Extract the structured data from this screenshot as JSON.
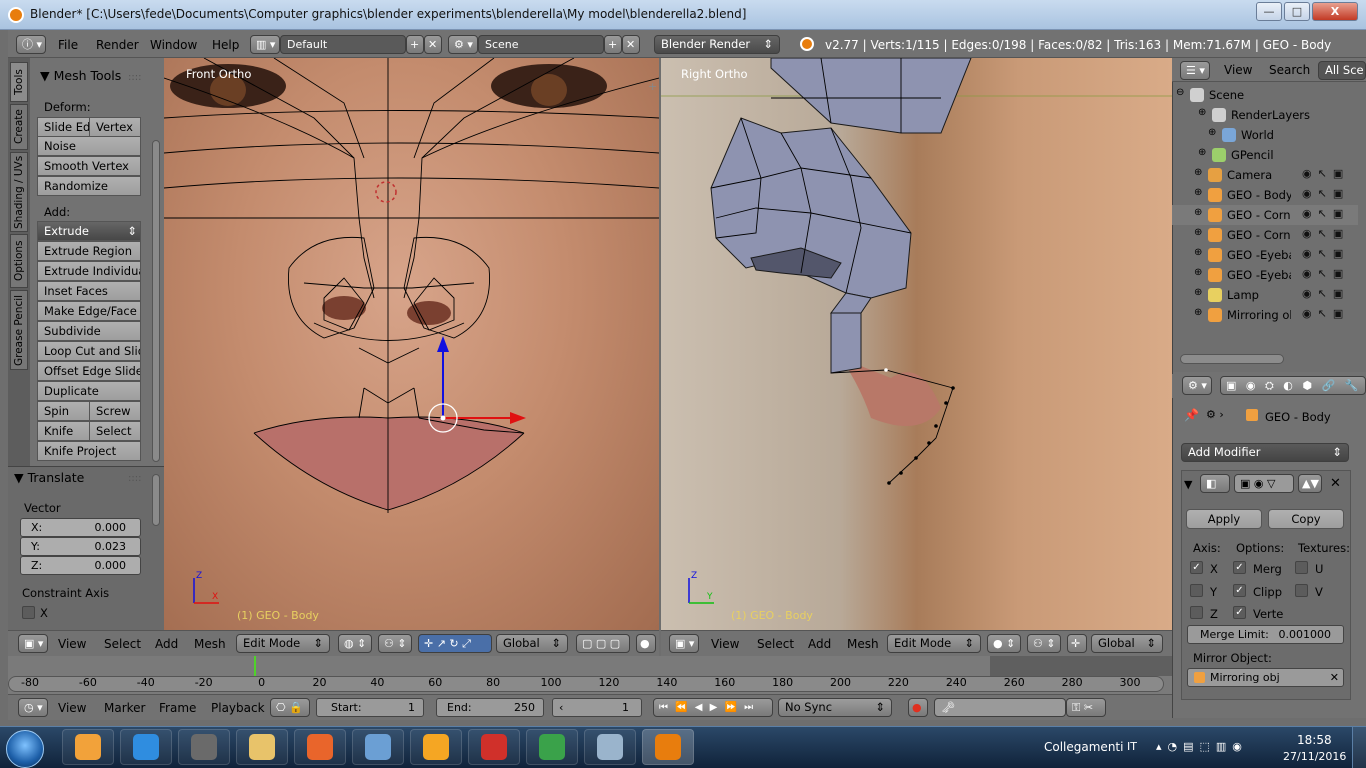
{
  "window": {
    "title": "Blender* [C:\\Users\\fede\\Documents\\Computer graphics\\blender experiments\\blenderella\\My model\\blenderella2.blend]",
    "minimize": "—",
    "maximize": "□",
    "close": "X"
  },
  "info_header": {
    "menus": [
      "File",
      "Render",
      "Window",
      "Help"
    ],
    "screen_layout": "Default",
    "scene": "Scene",
    "render_engine": "Blender Render",
    "stats": "v2.77 | Verts:1/115 | Edges:0/198 | Faces:0/82 | Tris:163 | Mem:71.67M | GEO - Body"
  },
  "left_tabs": [
    "Tools",
    "Create",
    "Shading / UVs",
    "Options",
    "Grease Pencil"
  ],
  "mesh_tools": {
    "title": "Mesh Tools",
    "deform_label": "Deform:",
    "slide_edge": "Slide Ed",
    "vertex": "Vertex",
    "noise": "Noise",
    "smooth_vertex": "Smooth Vertex",
    "randomize": "Randomize",
    "add_label": "Add:",
    "extrude": "Extrude",
    "add_items": [
      "Extrude Region",
      "Extrude Individual",
      "Inset Faces",
      "Make Edge/Face",
      "Subdivide",
      "Loop Cut and Slide",
      "Offset Edge Slide",
      "Duplicate"
    ],
    "spin": "Spin",
    "screw": "Screw",
    "knife": "Knife",
    "select": "Select",
    "knife_project": "Knife Project"
  },
  "translate": {
    "title": "Translate",
    "vector_label": "Vector",
    "x_label": "X:",
    "x_value": "0.000",
    "y_label": "Y:",
    "y_value": "0.023",
    "z_label": "Z:",
    "z_value": "0.000",
    "constraint_label": "Constraint Axis",
    "constraint_x": "X"
  },
  "viewport_front": {
    "label": "Front Ortho",
    "object": "(1) GEO - Body"
  },
  "viewport_right": {
    "label": "Right Ortho",
    "object": "(1) GEO - Body"
  },
  "view3d_header_left": {
    "menus": [
      "View",
      "Select",
      "Add",
      "Mesh"
    ],
    "mode": "Edit Mode",
    "orientation": "Global"
  },
  "view3d_header_right": {
    "menus": [
      "View",
      "Select",
      "Add",
      "Mesh"
    ],
    "mode": "Edit Mode",
    "orientation": "Global"
  },
  "timeline": {
    "ticks": [
      "-80",
      "-60",
      "-40",
      "-20",
      "0",
      "20",
      "40",
      "60",
      "80",
      "100",
      "120",
      "140",
      "160",
      "180",
      "200",
      "220",
      "240",
      "260",
      "280",
      "300"
    ],
    "current_frame_position": 0.2115,
    "menus": [
      "View",
      "Marker",
      "Frame",
      "Playback"
    ],
    "start_label": "Start:",
    "start_value": "1",
    "end_label": "End:",
    "end_value": "250",
    "current_frame": "1",
    "sync": "No Sync"
  },
  "outliner": {
    "header_menus": [
      "View",
      "Search"
    ],
    "display_mode": "All Sce",
    "items": [
      {
        "label": "Scene",
        "icon": "scene-icon",
        "color": "#d0d0d0"
      },
      {
        "label": "RenderLayers",
        "icon": "renderlayers-icon",
        "color": "#d0d0d0"
      },
      {
        "label": "World",
        "icon": "world-icon",
        "color": "#7aa6d8"
      },
      {
        "label": "GPencil",
        "icon": "gpencil-icon",
        "color": "#9ccf6b"
      },
      {
        "label": "Camera",
        "icon": "camera-icon",
        "color": "#e6a042"
      },
      {
        "label": "GEO - Body",
        "icon": "mesh-icon",
        "color": "#f0a040"
      },
      {
        "label": "GEO - Cornea",
        "icon": "mesh-icon",
        "color": "#f0a040"
      },
      {
        "label": "GEO - Cornea",
        "icon": "mesh-icon",
        "color": "#f0a040"
      },
      {
        "label": "GEO -Eyeball",
        "icon": "mesh-icon",
        "color": "#f0a040"
      },
      {
        "label": "GEO -Eyeball",
        "icon": "mesh-icon",
        "color": "#f0a040"
      },
      {
        "label": "Lamp",
        "icon": "lamp-icon",
        "color": "#e8d060"
      },
      {
        "label": "Mirroring obj",
        "icon": "mesh-icon",
        "color": "#f0a040"
      }
    ]
  },
  "properties": {
    "breadcrumb_object": "GEO - Body",
    "add_modifier": "Add Modifier",
    "apply": "Apply",
    "copy": "Copy",
    "axis_label": "Axis:",
    "options_label": "Options:",
    "textures_label": "Textures:",
    "axis_x": "X",
    "axis_y": "Y",
    "axis_z": "Z",
    "opt_merge": "Merg",
    "opt_clip": "Clipp",
    "opt_vertex": "Verte",
    "tex_u": "U",
    "tex_v": "V",
    "merge_limit_label": "Merge Limit:",
    "merge_limit_value": "0.001000",
    "mirror_object_label": "Mirror Object:",
    "mirror_object_value": "Mirroring obj"
  },
  "taskbar": {
    "apps": [
      "start-orb",
      "media-player",
      "internet-explorer",
      "gimp",
      "file-explorer",
      "firefox",
      "remote-desktop",
      "office-app",
      "marvelous-designer",
      "chrome",
      "calculator",
      "blender"
    ],
    "tray_label": "Collegamenti",
    "language": "IT",
    "time": "18:58",
    "date": "27/11/2016"
  },
  "colors": {
    "blender_orange": "#e87d0d",
    "mesh_wire": "#000000",
    "x_axis": "#e01010",
    "y_axis": "#10c010",
    "z_axis": "#1010e0"
  }
}
